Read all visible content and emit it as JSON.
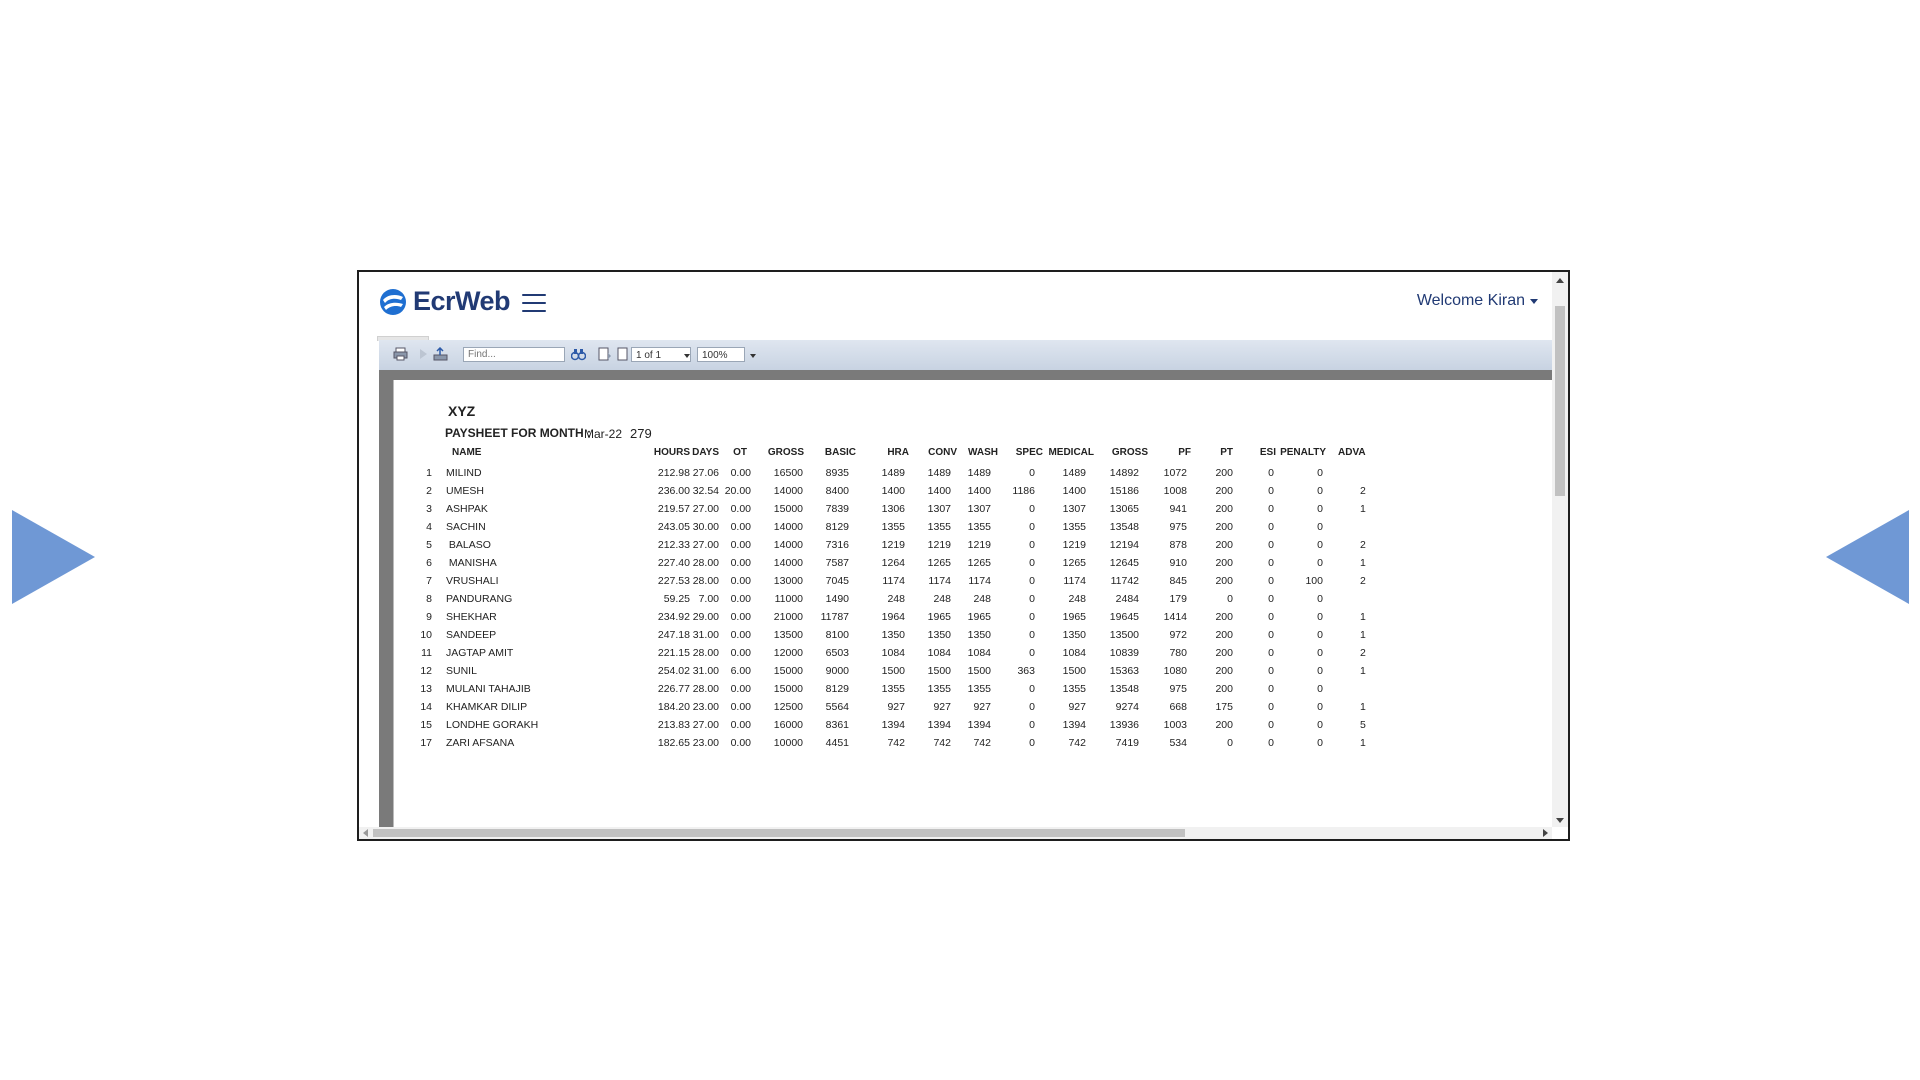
{
  "app": {
    "logo_text": "EcrWeb",
    "welcome": "Welcome Kiran"
  },
  "colors": {
    "accent": "#213a74",
    "nav_arrow": "#6f98d5",
    "logo_blue": "#1f6fd1"
  },
  "toolbar": {
    "find_placeholder": "Find...",
    "page_indicator": "1 of 1",
    "zoom": "100%"
  },
  "report": {
    "title": "XYZ",
    "heading": "PAYSHEET FOR MONTH :",
    "month": "Mar-22",
    "count": "279",
    "columns": [
      "NAME",
      "HOURS",
      "DAYS",
      "OT",
      "GROSS",
      "BASIC",
      "HRA",
      "CONV",
      "WASH",
      "SPEC",
      "MEDICAL",
      "GROSS",
      "PF",
      "PT",
      "ESI",
      "PENALTY",
      "ADVA"
    ],
    "rows": [
      [
        "1",
        "MILIND",
        "212.98",
        "27.06",
        "0.00",
        "16500",
        "8935",
        "1489",
        "1489",
        "1489",
        "0",
        "1489",
        "14892",
        "1072",
        "200",
        "0",
        "0",
        ""
      ],
      [
        "2",
        "UMESH",
        "236.00",
        "32.54",
        "20.00",
        "14000",
        "8400",
        "1400",
        "1400",
        "1400",
        "1186",
        "1400",
        "15186",
        "1008",
        "200",
        "0",
        "0",
        "2"
      ],
      [
        "3",
        "ASHPAK",
        "219.57",
        "27.00",
        "0.00",
        "15000",
        "7839",
        "1306",
        "1307",
        "1307",
        "0",
        "1307",
        "13065",
        "941",
        "200",
        "0",
        "0",
        "1"
      ],
      [
        "4",
        "SACHIN",
        "243.05",
        "30.00",
        "0.00",
        "14000",
        "8129",
        "1355",
        "1355",
        "1355",
        "0",
        "1355",
        "13548",
        "975",
        "200",
        "0",
        "0",
        ""
      ],
      [
        "5",
        " BALASO",
        "212.33",
        "27.00",
        "0.00",
        "14000",
        "7316",
        "1219",
        "1219",
        "1219",
        "0",
        "1219",
        "12194",
        "878",
        "200",
        "0",
        "0",
        "2"
      ],
      [
        "6",
        " MANISHA",
        "227.40",
        "28.00",
        "0.00",
        "14000",
        "7587",
        "1264",
        "1265",
        "1265",
        "0",
        "1265",
        "12645",
        "910",
        "200",
        "0",
        "0",
        "1"
      ],
      [
        "7",
        "VRUSHALI",
        "227.53",
        "28.00",
        "0.00",
        "13000",
        "7045",
        "1174",
        "1174",
        "1174",
        "0",
        "1174",
        "11742",
        "845",
        "200",
        "0",
        "100",
        "2"
      ],
      [
        "8",
        "PANDURANG",
        "59.25",
        "7.00",
        "0.00",
        "11000",
        "1490",
        "248",
        "248",
        "248",
        "0",
        "248",
        "2484",
        "179",
        "0",
        "0",
        "0",
        ""
      ],
      [
        "9",
        "SHEKHAR",
        "234.92",
        "29.00",
        "0.00",
        "21000",
        "11787",
        "1964",
        "1965",
        "1965",
        "0",
        "1965",
        "19645",
        "1414",
        "200",
        "0",
        "0",
        "1"
      ],
      [
        "10",
        "SANDEEP",
        "247.18",
        "31.00",
        "0.00",
        "13500",
        "8100",
        "1350",
        "1350",
        "1350",
        "0",
        "1350",
        "13500",
        "972",
        "200",
        "0",
        "0",
        "1"
      ],
      [
        "11",
        "JAGTAP AMIT",
        "221.15",
        "28.00",
        "0.00",
        "12000",
        "6503",
        "1084",
        "1084",
        "1084",
        "0",
        "1084",
        "10839",
        "780",
        "200",
        "0",
        "0",
        "2"
      ],
      [
        "12",
        "SUNIL",
        "254.02",
        "31.00",
        "6.00",
        "15000",
        "9000",
        "1500",
        "1500",
        "1500",
        "363",
        "1500",
        "15363",
        "1080",
        "200",
        "0",
        "0",
        "1"
      ],
      [
        "13",
        "MULANI TAHAJIB",
        "226.77",
        "28.00",
        "0.00",
        "15000",
        "8129",
        "1355",
        "1355",
        "1355",
        "0",
        "1355",
        "13548",
        "975",
        "200",
        "0",
        "0",
        ""
      ],
      [
        "14",
        "KHAMKAR DILIP",
        "184.20",
        "23.00",
        "0.00",
        "12500",
        "5564",
        "927",
        "927",
        "927",
        "0",
        "927",
        "9274",
        "668",
        "175",
        "0",
        "0",
        "1"
      ],
      [
        "15",
        "LONDHE GORAKH",
        "213.83",
        "27.00",
        "0.00",
        "16000",
        "8361",
        "1394",
        "1394",
        "1394",
        "0",
        "1394",
        "13936",
        "1003",
        "200",
        "0",
        "0",
        "5"
      ],
      [
        "17",
        "ZARI AFSANA",
        "182.65",
        "23.00",
        "0.00",
        "10000",
        "4451",
        "742",
        "742",
        "742",
        "0",
        "742",
        "7419",
        "534",
        "0",
        "0",
        "0",
        "1"
      ]
    ]
  }
}
